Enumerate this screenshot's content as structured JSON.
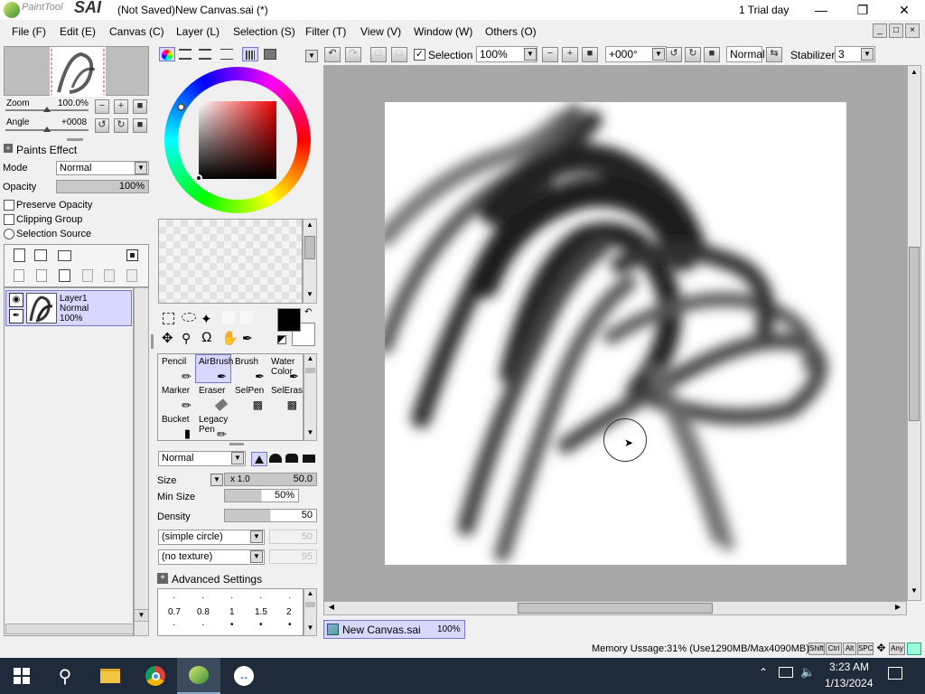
{
  "app": {
    "logo_text": "PaintTool",
    "logo_sai": "SAI",
    "window_title": "(Not Saved)New Canvas.sai (*)",
    "trial": "1 Trial day"
  },
  "menu": [
    "File (F)",
    "Edit (E)",
    "Canvas (C)",
    "Layer (L)",
    "Selection (S)",
    "Filter (T)",
    "View (V)",
    "Window (W)",
    "Others (O)"
  ],
  "navigator": {
    "zoom_label": "Zoom",
    "zoom_value": "100.0%",
    "angle_label": "Angle",
    "angle_value": "+0008"
  },
  "layer_panel": {
    "paints_effect": "Paints Effect",
    "mode_label": "Mode",
    "mode_value": "Normal",
    "opacity_label": "Opacity",
    "opacity_value": "100%",
    "preserve_opacity": "Preserve Opacity",
    "clipping_group": "Clipping Group",
    "selection_source": "Selection Source",
    "layers": [
      {
        "name": "Layer1",
        "mode": "Normal",
        "opacity": "100%"
      }
    ]
  },
  "toolbar": {
    "selection_label": "Selection",
    "selection_checked": true,
    "zoom": "100%",
    "angle": "+000°",
    "blend": "Normal",
    "stabilizer_label": "Stabilizer",
    "stabilizer_value": "3"
  },
  "tools": [
    {
      "label": "Pencil",
      "selected": false
    },
    {
      "label": "AirBrush",
      "selected": true
    },
    {
      "label": "Brush",
      "selected": false
    },
    {
      "label": "Water Color",
      "selected": false
    },
    {
      "label": "Marker",
      "selected": false
    },
    {
      "label": "Eraser",
      "selected": false
    },
    {
      "label": "SelPen",
      "selected": false
    },
    {
      "label": "SelEras",
      "selected": false
    },
    {
      "label": "Bucket",
      "selected": false
    },
    {
      "label": "Legacy Pen",
      "selected": false
    }
  ],
  "brush": {
    "blend_mode": "Normal",
    "size_label": "Size",
    "size_mult": "x 1.0",
    "size_value": "50.0",
    "min_size_label": "Min Size",
    "min_size_value": "50%",
    "density_label": "Density",
    "density_value": "50",
    "shape": "(simple circle)",
    "shape_value": "50",
    "texture": "(no texture)",
    "texture_value": "95",
    "advanced": "Advanced Settings",
    "dot_sizes": [
      "0.7",
      "0.8",
      "1",
      "1.5",
      "2"
    ]
  },
  "document_tab": {
    "name": "New Canvas.sai",
    "zoom": "100%"
  },
  "status": {
    "memory": "Memory Ussage:31% (Use1290MB/Max4090MB)",
    "keys": [
      "Shift",
      "Ctrl",
      "Alt",
      "SPC",
      "Any"
    ]
  },
  "taskbar": {
    "time": "3:23 AM",
    "date": "1/13/2024"
  },
  "colors": {
    "accent": "#7777cc",
    "taskbar": "#1f2a3a",
    "selected_tool": "#d8d8ff"
  }
}
